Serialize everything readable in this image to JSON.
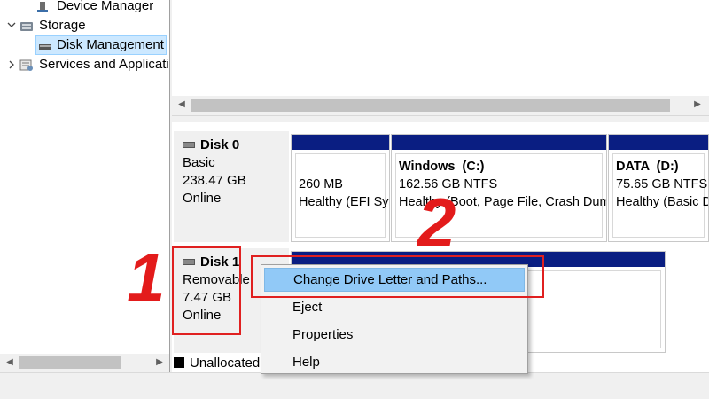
{
  "tree": {
    "items": [
      {
        "label": "Device Manager",
        "expander": "",
        "icon": "device-manager-icon"
      },
      {
        "label": "Storage",
        "expander": "⌄",
        "icon": "storage-icon"
      },
      {
        "label": "Disk Management",
        "expander": "",
        "icon": "disk-management-icon",
        "selected": true
      },
      {
        "label": "Services and Applications",
        "expander": "›",
        "icon": "services-applications-icon"
      }
    ]
  },
  "disks": [
    {
      "name": "Disk 0",
      "type": "Basic",
      "size": "238.47 GB",
      "status": "Online",
      "partitions": [
        {
          "title": "",
          "size": "260 MB",
          "status": "Healthy (EFI System Partition)"
        },
        {
          "title": "Windows  (C:)",
          "size": "162.56 GB NTFS",
          "status": "Healthy (Boot, Page File, Crash Dump, Primary Partition)"
        },
        {
          "title": "DATA  (D:)",
          "size": "75.65 GB NTFS",
          "status": "Healthy (Basic Data Partition)"
        }
      ]
    },
    {
      "name": "Disk 1",
      "type": "Removable",
      "size": "7.47 GB",
      "status": "Online"
    }
  ],
  "legend": {
    "unallocated": "Unallocated"
  },
  "context_menu": {
    "items": [
      {
        "label": "Change Drive Letter and Paths...",
        "highlighted": true
      },
      {
        "label": "Eject"
      },
      {
        "label": "Properties"
      },
      {
        "label": "Help"
      }
    ]
  },
  "annotations": {
    "step1": "1",
    "step2": "2",
    "color": "#e31b1b"
  },
  "colors": {
    "partition_band": "#0a1e82",
    "menu_highlight": "#91c9f7",
    "selection": "#cce8ff"
  }
}
